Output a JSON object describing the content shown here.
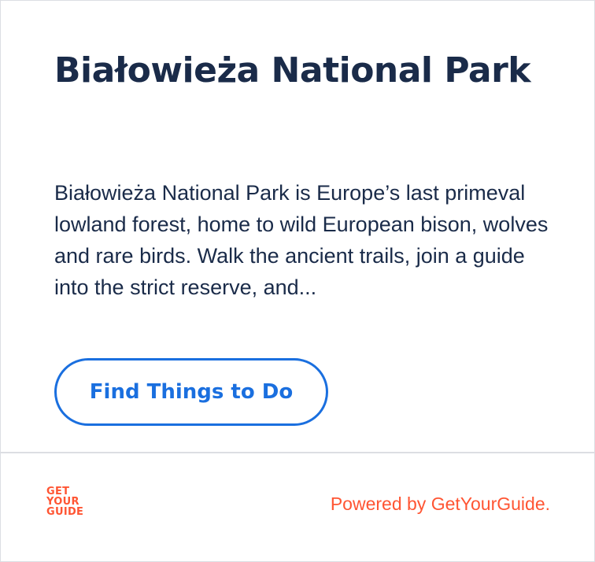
{
  "card": {
    "title": "Białowieża National Park",
    "description": "Białowieża National Park is Europe’s last primeval lowland forest, home to wild European bison, wolves and rare birds. Walk the ancient trails, join a guide into the strict reserve, and...",
    "cta_label": "Find Things to Do"
  },
  "footer": {
    "logo_lines": [
      "GET",
      "YOUR",
      "GUIDE"
    ],
    "powered_by": "Powered by GetYourGuide."
  },
  "colors": {
    "title": "#1a2b49",
    "accent": "#1a6fdf",
    "brand": "#ff5533",
    "border": "#dcdee3"
  }
}
